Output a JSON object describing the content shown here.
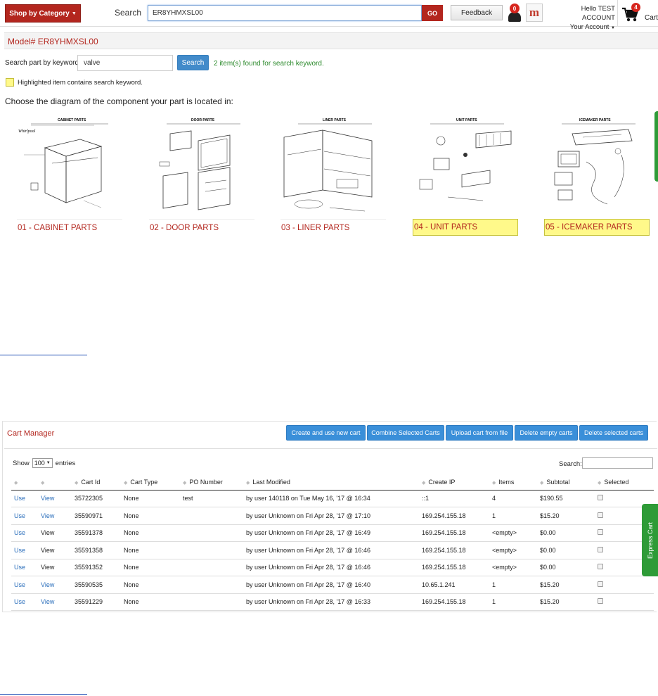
{
  "header": {
    "shop_by_category": "Shop by Category",
    "search_label": "Search",
    "search_value": "ER8YHMXSL00",
    "go_label": "GO",
    "feedback_label": "Feedback",
    "notification_count": "0",
    "account_greeting": "Hello TEST ACCOUNT",
    "account_link": "Your Account",
    "cart_count": "4",
    "cart_label": "Cart"
  },
  "model": {
    "title": "Model# ER8YHMXSL00",
    "keyword_label": "Search part by keyword:",
    "keyword_value": "valve",
    "keyword_button": "Search",
    "found_text": "2 item(s) found for search keyword.",
    "legend_text": "Highlighted item contains search keyword.",
    "choose_text": "Choose the diagram of the component your part is located in:",
    "diagrams": [
      {
        "label": "01 - CABINET PARTS",
        "highlighted": false,
        "image_title": "CABINET PARTS"
      },
      {
        "label": "02 - DOOR PARTS",
        "highlighted": false,
        "image_title": "DOOR PARTS"
      },
      {
        "label": "03 - LINER PARTS",
        "highlighted": false,
        "image_title": "LINER PARTS"
      },
      {
        "label": "04 - UNIT PARTS",
        "highlighted": true,
        "image_title": "UNIT PARTS"
      },
      {
        "label": "05 - ICEMAKER PARTS",
        "highlighted": true,
        "image_title": "ICEMAKER PARTS"
      }
    ],
    "brand_mark": "Whirlpool",
    "highlight_color": "#fff98a"
  },
  "cart_manager": {
    "title": "Cart Manager",
    "buttons": [
      "Create and use new cart",
      "Combine Selected Carts",
      "Upload cart from file",
      "Delete empty carts",
      "Delete selected carts"
    ],
    "show_label": "Show",
    "show_value": "100",
    "entries_label": "entries",
    "search_label": "Search:",
    "columns": [
      "",
      "",
      "Cart Id",
      "Cart Type",
      "PO Number",
      "Last Modified",
      "Create IP",
      "Items",
      "Subtotal",
      "Selected"
    ],
    "rows": [
      {
        "use": "Use",
        "view": "View",
        "cart_id": "35722305",
        "cart_type": "None",
        "po": "test",
        "modified": "by user 140118 on Tue May 16, '17 @ 16:34",
        "ip": "::1",
        "items": "4",
        "subtotal": "$190.55"
      },
      {
        "use": "Use",
        "view": "View",
        "cart_id": "35590971",
        "cart_type": "None",
        "po": "",
        "modified": "by user Unknown on Fri Apr 28, '17 @ 17:10",
        "ip": "169.254.155.18",
        "items": "1",
        "subtotal": "$15.20"
      },
      {
        "use": "Use",
        "view": "View",
        "cart_id": "35591378",
        "cart_type": "None",
        "po": "",
        "modified": "by user Unknown on Fri Apr 28, '17 @ 16:49",
        "ip": "169.254.155.18",
        "items": "<empty>",
        "subtotal": "$0.00"
      },
      {
        "use": "Use",
        "view": "View",
        "cart_id": "35591358",
        "cart_type": "None",
        "po": "",
        "modified": "by user Unknown on Fri Apr 28, '17 @ 16:46",
        "ip": "169.254.155.18",
        "items": "<empty>",
        "subtotal": "$0.00"
      },
      {
        "use": "Use",
        "view": "View",
        "cart_id": "35591352",
        "cart_type": "None",
        "po": "",
        "modified": "by user Unknown on Fri Apr 28, '17 @ 16:46",
        "ip": "169.254.155.18",
        "items": "<empty>",
        "subtotal": "$0.00"
      },
      {
        "use": "Use",
        "view": "View",
        "cart_id": "35590535",
        "cart_type": "None",
        "po": "",
        "modified": "by user Unknown on Fri Apr 28, '17 @ 16:40",
        "ip": "10.65.1.241",
        "items": "1",
        "subtotal": "$15.20"
      },
      {
        "use": "Use",
        "view": "View",
        "cart_id": "35591229",
        "cart_type": "None",
        "po": "",
        "modified": "by user Unknown on Fri Apr 28, '17 @ 16:33",
        "ip": "169.254.155.18",
        "items": "1",
        "subtotal": "$15.20"
      }
    ],
    "express_cart_label": "Express Cart"
  },
  "colors": {
    "brand_red": "#b3261e",
    "button_blue": "#3a8fd9",
    "link_blue": "#2a6ebb",
    "express_green": "#2e9b37"
  }
}
